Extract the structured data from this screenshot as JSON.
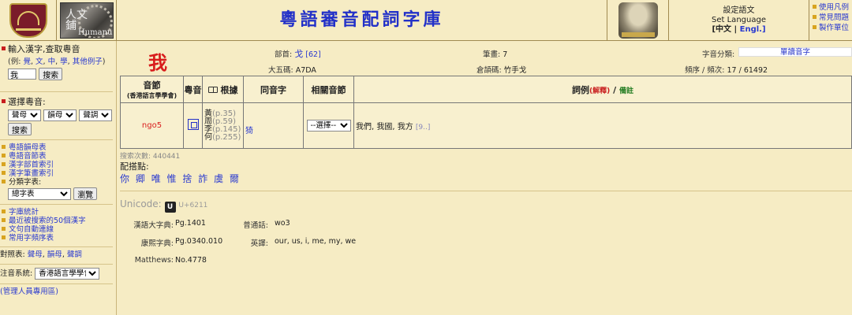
{
  "header": {
    "title": "粵語審音配詞字庫",
    "humanum_seal": "人文\n鋪",
    "humanum_word": "Humanum",
    "lang_title": "設定語文",
    "lang_title_en": "Set Language",
    "lang_zh": "[中文",
    "lang_sep": " | ",
    "lang_en": "Engl.]",
    "help_links": [
      "使用凡例",
      "常見問題",
      "製作單位"
    ]
  },
  "sidebar": {
    "search_title": "輸入漢字,查取粵音",
    "example_prefix": "(例: ",
    "examples": [
      "覺",
      "文",
      "中",
      "學",
      "其他例子"
    ],
    "example_suffix": ")",
    "search_value": "我",
    "search_button": "搜索",
    "pron_title": "選擇粵音:",
    "initial_select": "聲母",
    "final_select": "韻母",
    "tone_select": "聲調",
    "pron_button": "搜索",
    "nav1": [
      "粵語韻母表",
      "粵語音節表",
      "漢字部首索引",
      "漢字筆畫索引"
    ],
    "category_label": "分類字表:",
    "category_select": "總字表",
    "browse_button": "瀏覽",
    "nav2": [
      "字庫統計",
      "最近被搜索的50個漢字",
      "文句自動連線",
      "常用字頻序表"
    ],
    "compare_prefix": "對照表: ",
    "compare_links": [
      "聲母",
      "韻母",
      "聲調"
    ],
    "system_label": "注音系統:",
    "system_select": "香港語言學學會",
    "admin_link": "(管理人員專用區)"
  },
  "entry": {
    "char": "我",
    "radical_label": "部首:",
    "radical_value": "戈",
    "radical_num": "[62]",
    "strokes_label": "筆畫:",
    "strokes_value": "7",
    "category_label": "字音分類:",
    "category_value": "單讀音字",
    "big5_label": "大五碼:",
    "big5_value": "A7DA",
    "cangjie_label": "倉頡碼:",
    "cangjie_value": "竹手戈",
    "freq_label": "頻序 / 頻次:",
    "freq_value": "17 / 61492"
  },
  "table": {
    "headers": {
      "syllable": "音節",
      "syllable_sub": "(香港語言學學會)",
      "audio": "粵音",
      "basis": "根據",
      "homophones": "同音字",
      "related": "相關音節",
      "words": "詞例",
      "explain": "(解釋)",
      "slash": " / ",
      "notes": "備註"
    },
    "row": {
      "jyutping": "ngo5",
      "refs": [
        {
          "src": "黃",
          "pg": "(p.35)"
        },
        {
          "src": "周",
          "pg": "(p.59)"
        },
        {
          "src": "李",
          "pg": "(p.145)"
        },
        {
          "src": "何",
          "pg": "(p.255)"
        }
      ],
      "homophone": "猗",
      "related_select": "--選擇--",
      "words": "我們, 我國, 我方",
      "more": "[9..]"
    }
  },
  "extra": {
    "search_count_label": "搜索次數: ",
    "search_count": "440441",
    "colloc_title": "配搭點:",
    "colloc_chars": [
      "你",
      "卿",
      "唯",
      "惟",
      "捨",
      "詐",
      "虞",
      "爾"
    ],
    "unicode_label": "Unicode: ",
    "unicode_code": "U+6211",
    "hanyu_label": "漢語大字典:",
    "hanyu_value": "Pg.1401",
    "putonghua_label": "普通話:",
    "putonghua_value": "wo3",
    "kangxi_label": "康熙字典:",
    "kangxi_value": "Pg.0340.010",
    "english_label": "英譯:",
    "english_value": "our, us, i, me, my, we",
    "matthews_label": "Matthews:",
    "matthews_value": "No.4778"
  }
}
